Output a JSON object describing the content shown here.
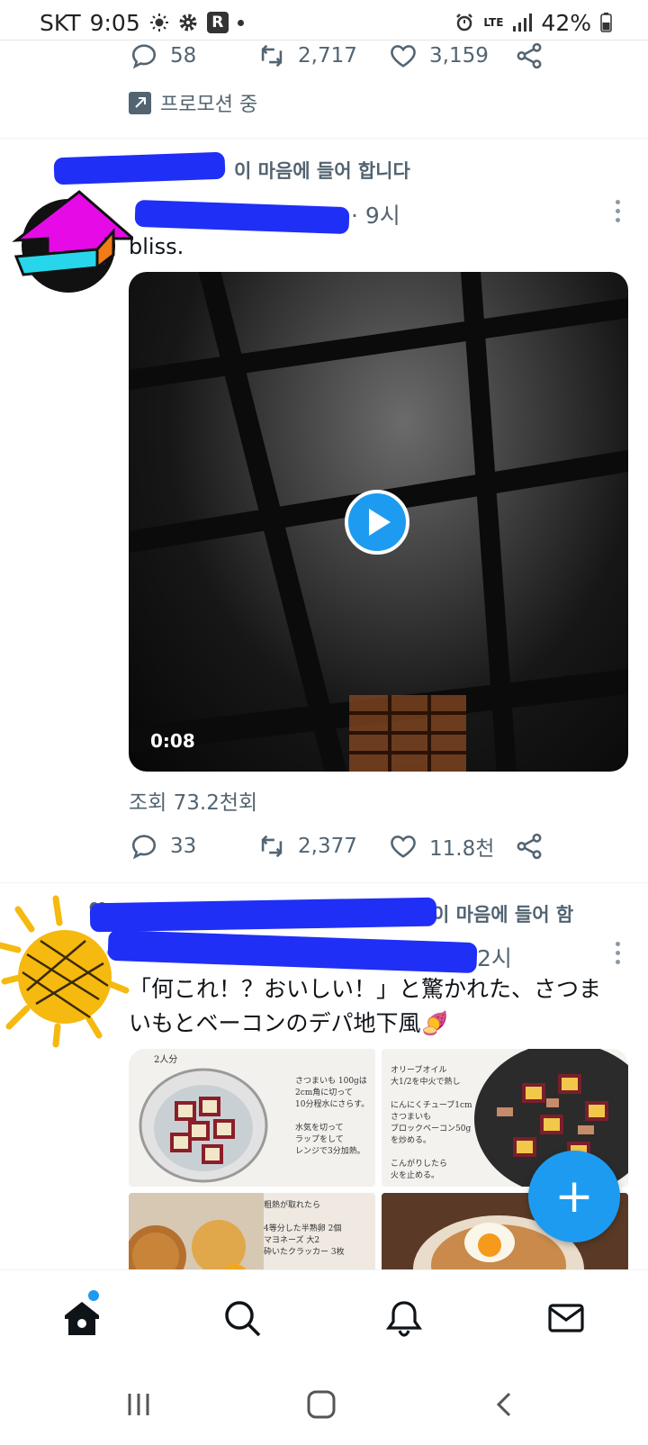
{
  "status_bar": {
    "carrier": "SKT",
    "time": "9:05",
    "network": "LTE",
    "battery": "42%"
  },
  "tweet1_actions": {
    "reply_count": "58",
    "retweet_count": "2,717",
    "like_count": "3,159",
    "promoted_label": "프로모션 중"
  },
  "tweet2": {
    "context_visible": "이 마음에 들어 합니다",
    "handle_visible": "· 9시",
    "text": "bliss.",
    "video_duration": "0:08",
    "views": "조회 73.2천회",
    "reply_count": "33",
    "retweet_count": "2,377",
    "like_count": "11.8천"
  },
  "tweet3": {
    "context_visible": "이 마음에 들어 함",
    "time_visible": "2시",
    "text": "「何これ！？おいしい！」と驚かれた、さつまいもとベーコンのデパ地下風🍠",
    "photo1_note": "さつまいも 100gは\n2cm角に切って\n10分程水にさらす。\n\n水気を切って\nラップをして\nレンジで3分加熱。",
    "photo1_label": "2人分",
    "photo2_note": "オリーブオイル\n大1/2を中火で熱し\n\nにんにくチューブ1cm\nさつまいも\nブロックベーコン50g\nを炒める。\n\nこんがりしたら\n火を止める。",
    "photo3_note": "粗熱が取れたら\n\n4等分した半熟卵 2個\nマヨネーズ 大2\n砕いたクラッカー 3枚\n\nをざっと混ぜ合わせて完成。"
  },
  "colors": {
    "accent": "#1d9bf0",
    "scribble": "#1f2ff5",
    "secondary_text": "#536471"
  }
}
